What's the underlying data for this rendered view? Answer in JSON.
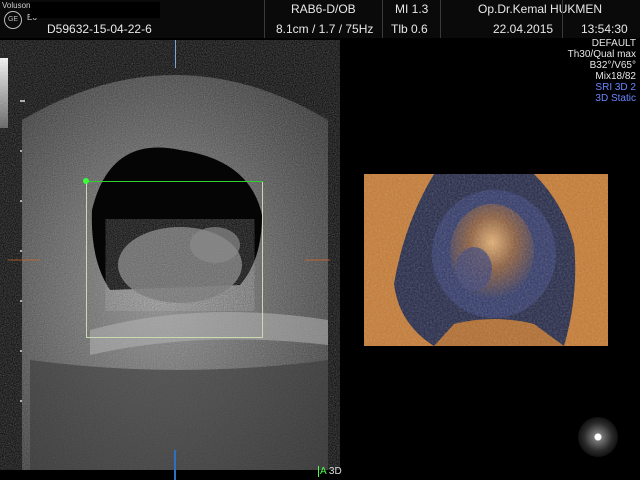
{
  "header": {
    "brand": "Voluson™",
    "logo": "GE",
    "model": "E6",
    "patient_id": "D59632-15-04-22-6",
    "probe_mode": "RAB6-D/OB",
    "depth": "8.1cm / 1.7 / 75Hz",
    "mi": "MI  1.3",
    "tib": "Tlb  0.6",
    "operator": "Op.Dr.Kemal HUKMEN",
    "date": "22.04.2015",
    "time": "13:54:30"
  },
  "params": {
    "line1": "DEFAULT",
    "line2": "Th30/Qual max",
    "line3": "B32°/V65°",
    "line4": "Mix18/82",
    "line5": "SRI 3D 2",
    "line6": "3D Static"
  },
  "colors": {
    "box_top": "#2fd02f",
    "box_border": "#c9d9b0",
    "mode_blue": "#6b86ff",
    "render_orange": "#d7842e",
    "render_blue": "#2a3466"
  },
  "footer": {
    "mark_a": "A",
    "mark_3d": "3D"
  }
}
